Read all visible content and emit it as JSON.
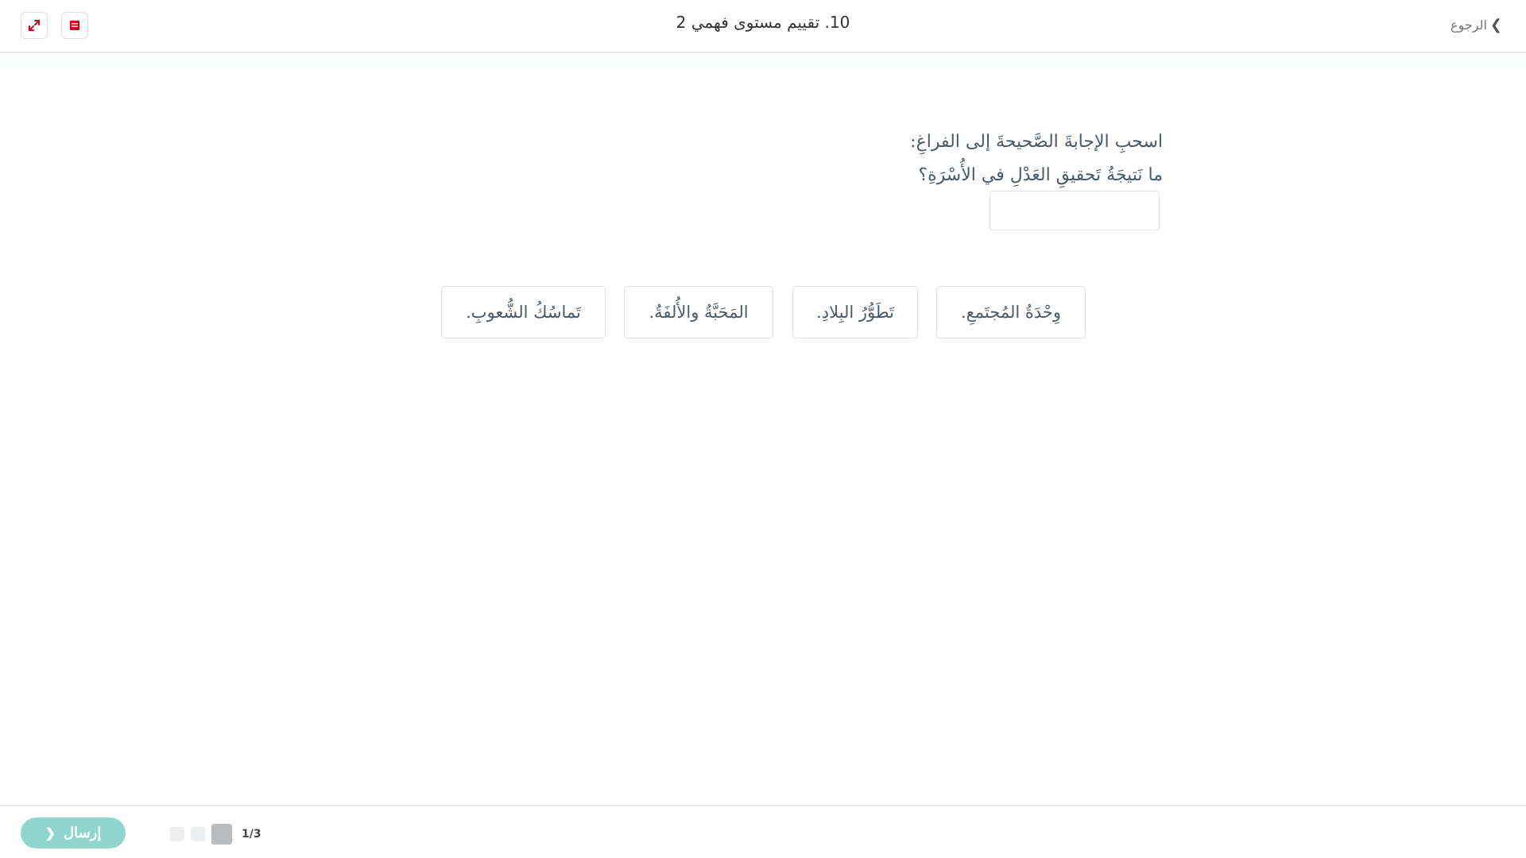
{
  "header": {
    "title": "10. تقييم مستوى فهمي 2",
    "back_label": "الرجوع",
    "expand_icon": "expand-arrows-icon",
    "book_icon": "book-icon",
    "accent_color": "#d0021b"
  },
  "question": {
    "instruction": "اسحبِ الإجابةَ الصَّحيحةَ إلى الفراغِ:",
    "prompt": "ما نَتيجَةُ تَحقيقِ العَدْلِ في الأُسْرَةِ؟"
  },
  "choices": [
    {
      "label": "وِحْدَةُ المُجتَمعِ."
    },
    {
      "label": "تَطَوُّرُ البِلادِ."
    },
    {
      "label": "المَحَبَّةُ والأُلفَةُ."
    },
    {
      "label": "تَماسُكُ الشُّعوبِ."
    }
  ],
  "footer": {
    "submit_label": "إرسال",
    "page_indicator": "1/3",
    "submit_color": "#8fd6cf"
  }
}
